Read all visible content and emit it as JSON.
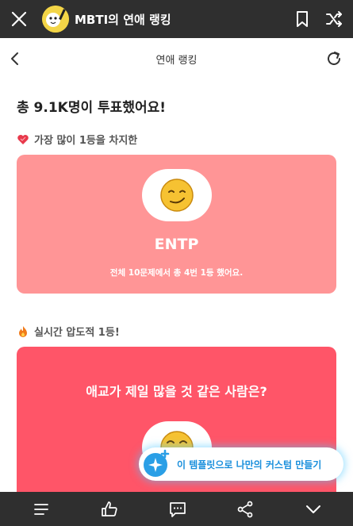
{
  "top_bar": {
    "title": "MBTI의 연애 랭킹",
    "icons": [
      "close-icon",
      "avatar",
      "bookmark-icon",
      "shuffle-icon"
    ]
  },
  "sub_header": {
    "title": "연애 랭킹",
    "icons": [
      "back-icon",
      "refresh-icon"
    ]
  },
  "summary": {
    "total_votes_text": "총 9.1K명이 투표했어요!"
  },
  "sections": [
    {
      "label": "가장 많이 1등을 차지한",
      "icon": "heart-icon",
      "card": {
        "mbti": "ENTP",
        "description": "전체 10문제에서 총 4번 1등 했어요.",
        "face_icon": "smirk-face-icon",
        "color": "#ff9596"
      }
    },
    {
      "label": "실시간 압도적 1등!",
      "icon": "fire-icon",
      "card": {
        "question": "애교가 제일 많을 것 같은 사람은?",
        "face_icon": "face-icon",
        "color": "#ff5568"
      }
    }
  ],
  "fab": {
    "label": "이 템플릿으로 나만의 커스텀 만들기",
    "icon": "sparkle-icon"
  },
  "bottom_bar": {
    "icons": [
      "menu-icon",
      "thumbs-up-icon",
      "comment-icon",
      "share-icon",
      "chevron-down-icon"
    ]
  },
  "colors": {
    "bar_bg": "#2f2f2f",
    "accent_blue": "#1a8fdc"
  }
}
